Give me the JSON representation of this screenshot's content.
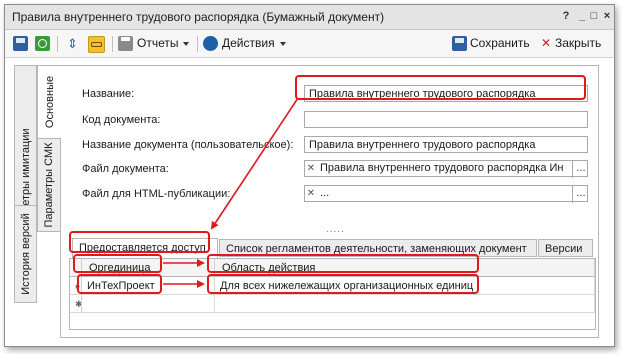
{
  "window": {
    "title": "Правила внутреннего трудового распорядка (Бумажный документ)",
    "controls": {
      "help": "?",
      "minimize": "_",
      "maximize": "□",
      "close": "×"
    }
  },
  "toolbar": {
    "reports_label": "Отчеты",
    "actions_label": "Действия",
    "save_label": "Сохранить",
    "close_label": "Закрыть",
    "icons": [
      "save-icon",
      "refresh-icon",
      "expand-icon",
      "link-icon",
      "print-icon",
      "actions-icon"
    ]
  },
  "side_tabs": [
    "Основные",
    "Параметры имитации",
    "Параметры СМК",
    "История версий"
  ],
  "form": {
    "name_label": "Название:",
    "name_value": "Правила внутреннего трудового распорядка",
    "code_label": "Код документа:",
    "code_value": "",
    "custom_name_label": "Название документа (пользовательское):",
    "custom_name_value": "Правила внутреннего трудового распорядка",
    "file_label": "Файл документа:",
    "file_value": "Правила внутреннего трудового распорядка Ин",
    "html_file_label": "Файл для HTML-публикации:",
    "html_file_value": "...",
    "clear_glyph": "✕",
    "ellipsis_glyph": "...",
    "splitter": "....."
  },
  "bottom_tabs": [
    "Предоставляется доступ",
    "Список регламентов деятельности, заменяющих документ",
    "Версии"
  ],
  "grid": {
    "columns": [
      "Оргединица",
      "Область действия"
    ],
    "rows": [
      {
        "indicator": "▸",
        "org": "ИнТехПроект",
        "scope": "Для всех нижележащих организационных единиц"
      }
    ],
    "new_row_marker": "✱"
  },
  "colors": {
    "highlight": "#e0191b",
    "accent": "#1f5fa8"
  }
}
